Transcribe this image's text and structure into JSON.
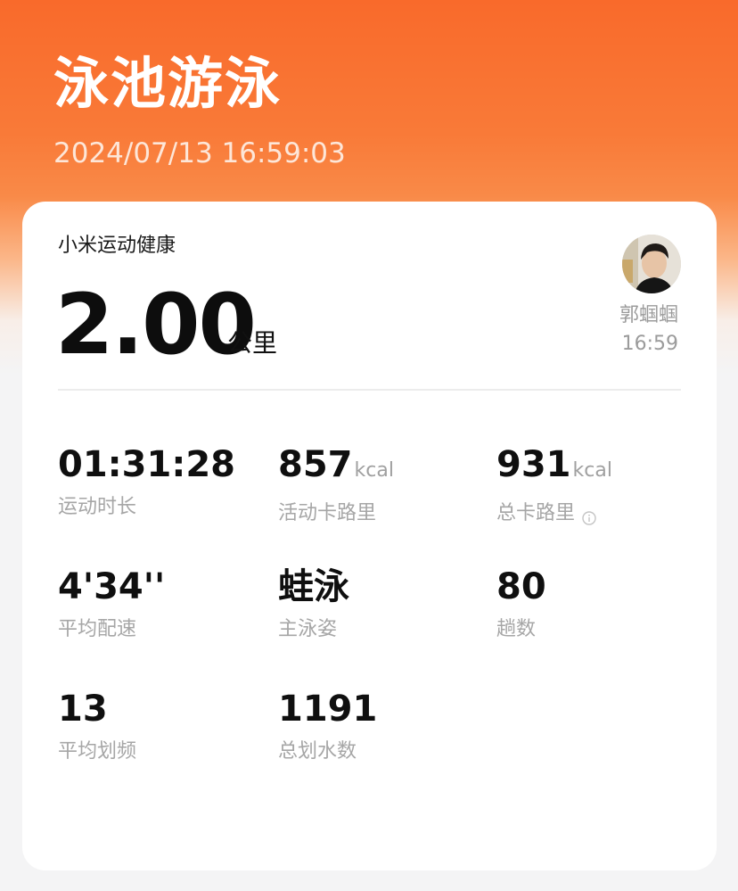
{
  "header": {
    "title": "泳池游泳",
    "datetime": "2024/07/13 16:59:03"
  },
  "summary": {
    "source": "小米运动健康",
    "distance_value": "2.00",
    "distance_unit": "公里",
    "user_name": "郭蝈蝈",
    "user_time": "16:59",
    "avatar_icon": "user-avatar-photo"
  },
  "stats": [
    {
      "value": "01:31:28",
      "unit": "",
      "label": "运动时长"
    },
    {
      "value": "857",
      "unit": "kcal",
      "label": "活动卡路里"
    },
    {
      "value": "931",
      "unit": "kcal",
      "label": "总卡路里",
      "icon": "info-icon"
    },
    {
      "value": "4'34''",
      "unit": "",
      "label": "平均配速"
    },
    {
      "value": "蛙泳",
      "unit": "",
      "label": "主泳姿"
    },
    {
      "value": "80",
      "unit": "",
      "label": "趟数"
    },
    {
      "value": "13",
      "unit": "",
      "label": "平均划频"
    },
    {
      "value": "1191",
      "unit": "",
      "label": "总划水数"
    }
  ],
  "colors": {
    "header_orange": "#f96a2b",
    "card_background": "#ffffff",
    "label_gray": "#a6a6a6"
  }
}
